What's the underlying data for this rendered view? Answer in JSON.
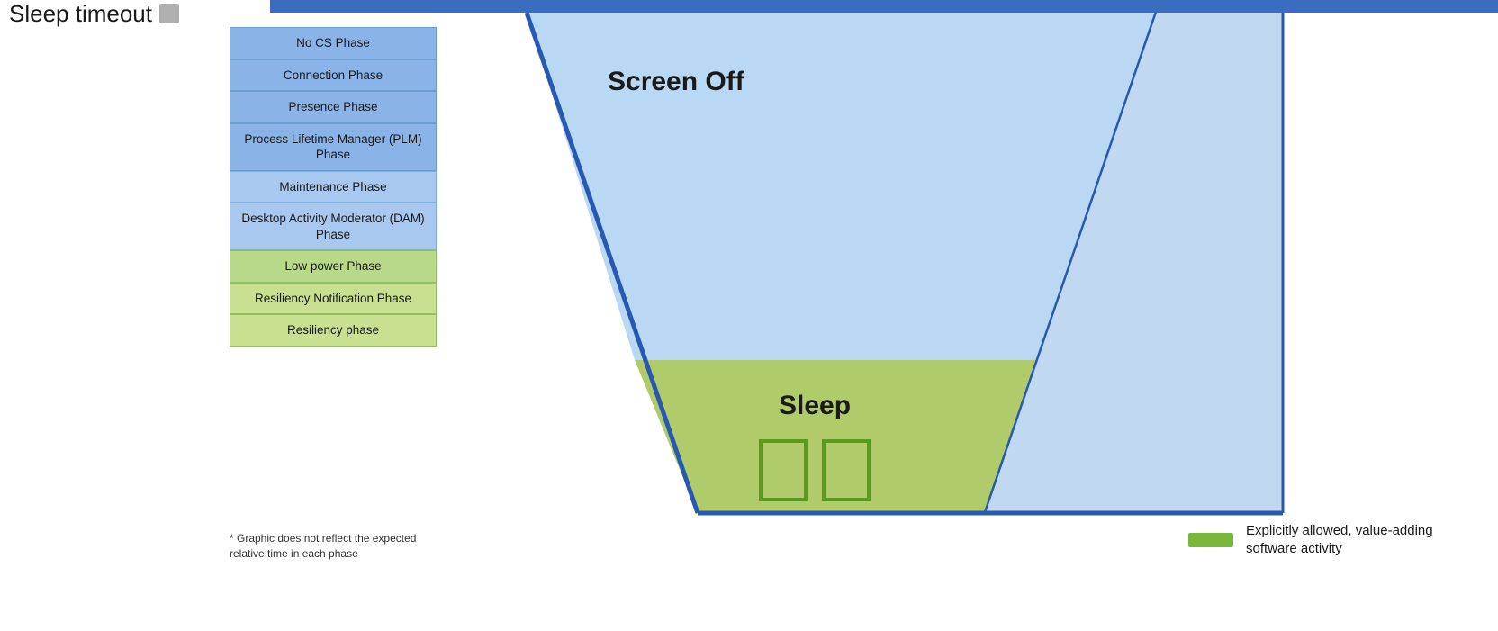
{
  "header": {
    "sleep_timeout_label": "Sleep timeout"
  },
  "phases": [
    {
      "id": "no-cs",
      "label": "No CS Phase",
      "style": "blue"
    },
    {
      "id": "connection",
      "label": "Connection Phase",
      "style": "blue"
    },
    {
      "id": "presence",
      "label": "Presence Phase",
      "style": "blue"
    },
    {
      "id": "plm",
      "label": "Process Lifetime Manager (PLM) Phase",
      "style": "blue"
    },
    {
      "id": "maintenance",
      "label": "Maintenance Phase",
      "style": "blue-light"
    },
    {
      "id": "dam",
      "label": "Desktop Activity Moderator (DAM) Phase",
      "style": "blue-light"
    },
    {
      "id": "low-power",
      "label": "Low power Phase",
      "style": "green"
    },
    {
      "id": "resiliency-notification",
      "label": "Resiliency Notification Phase",
      "style": "green-light"
    },
    {
      "id": "resiliency",
      "label": "Resiliency phase",
      "style": "green-light"
    }
  ],
  "footnote": "* Graphic does not reflect the expected relative time in each phase",
  "diagram": {
    "screen_off_label": "Screen Off",
    "sleep_label": "Sleep"
  },
  "legend": {
    "swatch_color": "#7ab83c",
    "text": "Explicitly allowed, value-adding software activity"
  },
  "colors": {
    "blue_accent": "#3a6cbf",
    "blue_fill": "#8ab4e8",
    "blue_light_fill": "#b8d4f0",
    "green_fill": "#a8d060",
    "green_sleep": "#b0cc70",
    "stroke": "#3060b0"
  }
}
